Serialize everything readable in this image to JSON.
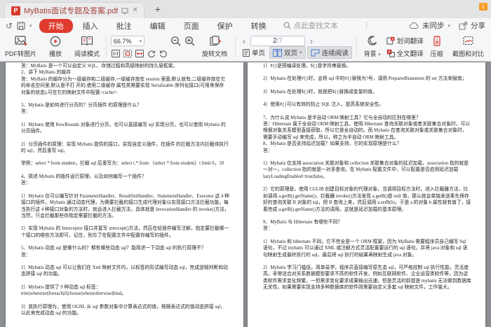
{
  "tab_bar": {
    "tab_title": "MyBatis面试专题及答案.pdf",
    "badge": "1"
  },
  "icons": {
    "close": "✕",
    "plus": "+",
    "chevron_down": "▾",
    "ellipsis": "⋮",
    "prev": "‹",
    "next": "›",
    "undo": "↺"
  },
  "menu": {
    "items": [
      {
        "label": "开始"
      },
      {
        "label": "插入"
      },
      {
        "label": "批注"
      },
      {
        "label": "编辑"
      },
      {
        "label": "页面"
      },
      {
        "label": "保护"
      },
      {
        "label": "转换"
      }
    ],
    "search_placeholder": "点此查找文本",
    "sync_label": "未同步",
    "share_label": "分享"
  },
  "toolbar": {
    "pdf_to_image": "PDF转图片",
    "play": "播放",
    "read_mode": "阅读模式",
    "zoom_value": "66.7%",
    "rotate_doc": "旋转文档",
    "page_current": "2",
    "page_total": "/7",
    "single_page": "单页",
    "double_page": "双页",
    "continuous": "连续阅读",
    "background": "背景",
    "word_translate": "划词翻译",
    "full_translate": "全文翻译",
    "compress": "压缩",
    "screenshot_compare": "截图和对比"
  },
  "colors": {
    "accent_red": "#df3b2e",
    "icon_blue": "#4a7fd6",
    "tab_title": "#a6433c",
    "doc_background": "#8b8e92"
  },
  "document": {
    "left_page": {
      "paragraphs": [
        "答：MyBatis 是一个可以自定义 SQL、存储过程和高级映射的持久层框架。\n2、讲下 MyBatis 的缓存\n答：MyBatis 的缓存分为一级缓存和二级缓存,一级缓存放在 session 里面,默认就有,二级缓存放在它的命名空间里,默认是不打 开的,使用二级缓存 属性类需要实现 Serializable 序列化接口(可用来保存 对象的状态),可在它的映射文件中配置<cache/>",
        "3、Mybatis 是如何进行分页的？分页插件 的原理是什么？\n答：",
        "1）Mybatis 使用 RowBounds 对象进行分页，也可以直接编写 sql 实现分页，也可以使用 Mybatis 的分页插件。",
        "2）分页插件的原理：实现 Mybatis 提供的接口，实现自定义插件，在插件 的拦截方法内拦截待执行的 sql，然后重写 sql。",
        "举例：select * from student，拦截 sql 后重写为：select t.* from （select * from student）t limit 0，10",
        "4、简述 Mybatis 的插件运行原理，以及如何编写一个插件？\n答：",
        "1）Mybatis 仅可以编写针对 ParameterHandler、ResultSetHandler、StatementHandler、Executor 这 4 种接口的插件，Mybatis 通过动态代理，为需要拦截的接口生成代理对象以实现接口方法拦截功能，每当执行这 4 种接口对象的方法时，就会进入拦截方法，具体就是 InvocationHandler 的 invoke()方法，当然，只会拦截那些你指定需要拦截的方法。",
        "2）实现 Mybatis 的 Interceptor 接口并复写 intercept()方法，然后在给插件编写注解，指定要拦截哪一个接口的哪些方法即可，记住，别忘了在配置文件中配置你编写的插件。",
        "5、Mybatis 动态 sql 是做什么的？都有哪些动态 sql？能简述一下动态 sql 的执行原理不？\n答：",
        "1）Mybatis 动态 sql 可以让我们在 Xml 映射文件内，以标签的形式编写动态 sql，完成逻辑判断和动态拼接 sql 的功能。",
        "2）Mybatis 提供了 9 种动态 sql 标签：\ntrim|where|set|foreach|if|choose|when|otherwise|bind。",
        "3）其执行原理为，使用 OGNL 从 sql 参数对象中计算表达式的值，根据表达式的值动态拼接 sql，以此来完成动态 sql 的功能。"
      ]
    },
    "right_page": {
      "paragraphs": [
        "1）#{}是预编译处理，${}是字符串替换。",
        "2）Mybatis 在处理#{}时，会将 sql 中的#{}替换为?号，调用 PreparedStatement 的 set 方法来赋值；",
        "3）Mybatis 在处理${}时，就是把${}替换成变量的值。",
        "4）使用#{}可以有效的防止 SQL 注入，提高系统安全性。",
        "7、为什么说 Mybatis 是半自动 ORM 映射工具？它与全自动的区别在哪里？\n答：Hibernate 属于全自动 ORM 映射工具，使用 Hibernate 查询关联对象或者关联集合对象时，可以根据对象关系模型直接获取，所以它是全自动的。而 Mybatis 在查询关联对象或关联集合对象时，需要手动编写 sql 来完成，所以，称之为半自动 ORM 映射工具。\n8、Mybatis 是否支持延迟加载？如果支持，它的实现原理是什么？\n答：",
        "1）Mybatis 仅支持 association 关联对象和 collection 关联集合对象的延迟加载，association 指的就是一对一，collection 指的就是一对多查询。在 Mybatis 配置文件中，可以配置是否启用延迟加载 lazyLoadingEnabled=true|false。",
        "2）它的原理是，使用 CGLIB 创建目标对象的代理对象，当调用目标方法时，进入拦截器方法，比如调用 a.getB().getName()，拦截器 invoke()方法发现 a.getB()是 null 值，那么就会单独发送事先保存好的查询关联 B 对象的 sql，把 B 查询上来，然后调用 a.setB(b)，于是 a 的对象 b 属性就有值了，接着完成 a.getB().getName()方法的调用。这就是延迟加载的基本原理。",
        "9、MyBatis 与 Hibernate 有哪些不同？\n答：",
        "1）Mybatis 和 hibernate 不同，它不完全是一个 ORM 框架，因为 MyBatis 需要程序员自己编写 Sql 语句，不过 mybatis 可以通过 XML 或注解方式灵活配置要运行的 sql 语句，并将 java 对象和 sql 语句映射生成最终执行的 sql，最后将 sql 执行的结果再映射生成 java 对象。",
        "2）Mybatis 学习门槛低，简单易学，程序员直接编写原生态 sql，可严格控制 sql 执行性能，灵活度高，非常适合对关系数据模型要求不高的软件开发，例如互联网软件、企业运营类软件等，因为这类软件需求变化频繁，一但需求变化要求成果输出迅速。但是灵活的前提是 mybatis 无法做到数据库无关性，如果需要实现支持多种数据库的软件则需要自定义多套 sql 映射文件，工作量大。"
      ]
    }
  }
}
